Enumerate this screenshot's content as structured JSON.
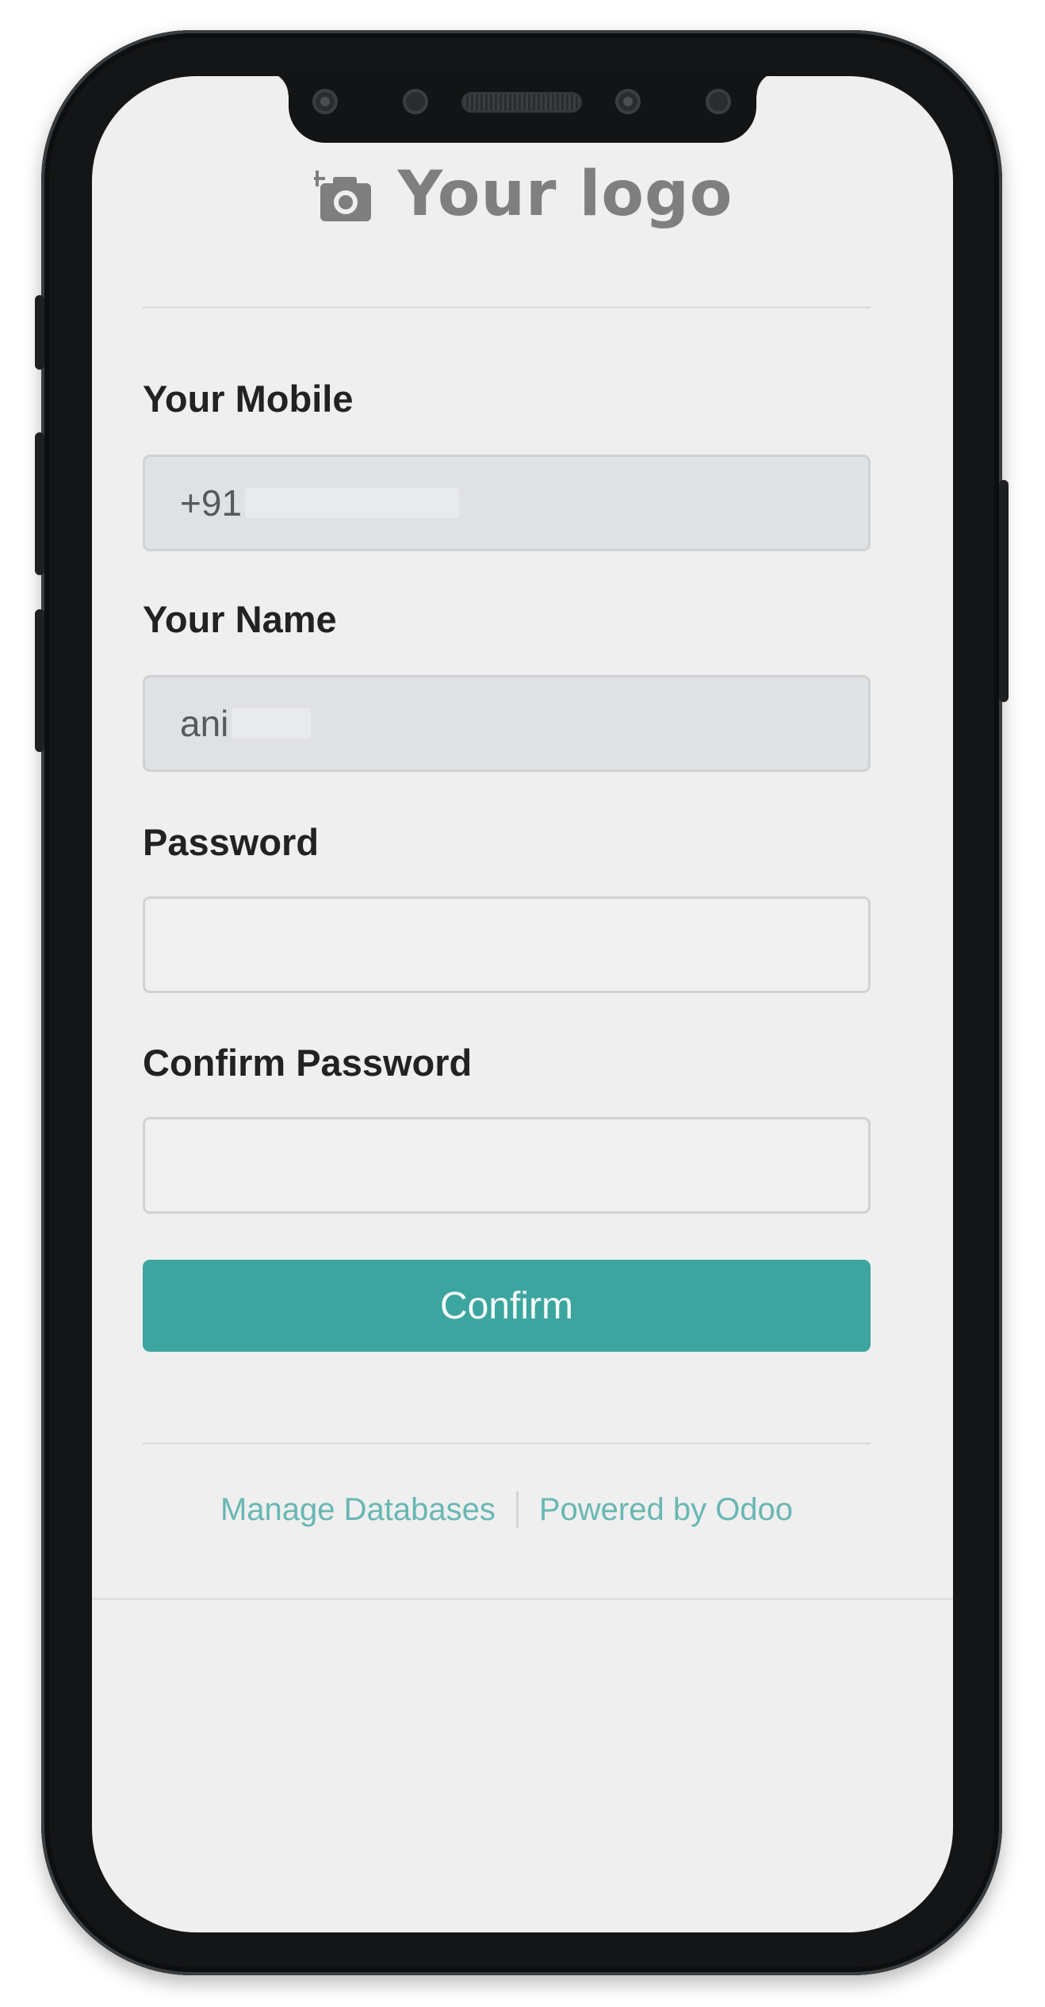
{
  "logo": {
    "text": "Your logo",
    "icon": "add-photo-camera-icon"
  },
  "form": {
    "mobile_label": "Your Mobile",
    "mobile_value_visible": "+91",
    "name_label": "Your Name",
    "name_value_visible": "ani",
    "password_label": "Password",
    "password_value": "",
    "confirm_password_label": "Confirm Password",
    "confirm_password_value": "",
    "confirm_button": "Confirm"
  },
  "footer": {
    "manage_databases": "Manage Databases",
    "powered_by": "Powered by Odoo"
  },
  "colors": {
    "accent": "#3ca59f",
    "link": "#68b7b3",
    "readonly_field": "#dfe1e3",
    "screen_bg": "#efefef"
  }
}
